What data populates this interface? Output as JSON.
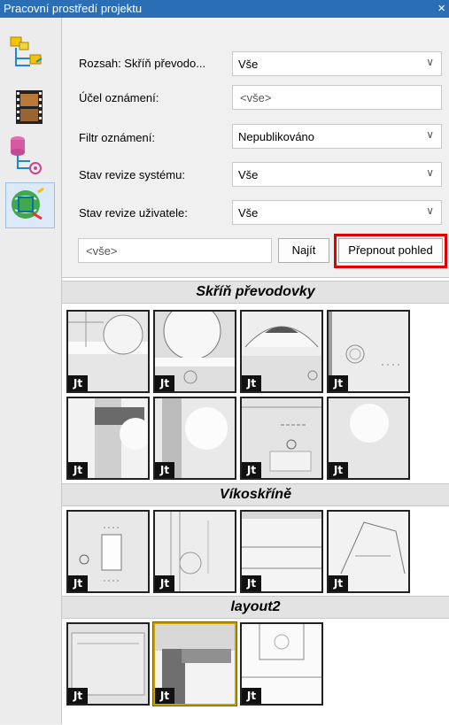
{
  "window": {
    "title": "Pracovní prostředí projektu",
    "close_glyph": "×"
  },
  "sidebar": {
    "icons": [
      "structure-tree-icon",
      "film-icon",
      "database-tree-icon",
      "globe-cube-icon"
    ],
    "active_index": 3
  },
  "form": {
    "scope_label": "Rozsah: Skříň převodo...",
    "scope_value": "Vše",
    "purpose_label": "Účel oznámení:",
    "purpose_value": "<vše>",
    "filter_label": "Filtr oznámení:",
    "filter_value": "Nepublikováno",
    "system_rev_label": "Stav revize systému:",
    "system_rev_value": "Vše",
    "user_rev_label": "Stav revize uživatele:",
    "user_rev_value": "Vše",
    "search_value": "<vše>",
    "find_button": "Najít",
    "switch_view_button": "Přepnout pohled"
  },
  "gallery": {
    "groups": [
      {
        "title": "Skříň převodovky",
        "thumbnail_count": 8
      },
      {
        "title": "Víkoskříně",
        "thumbnail_count": 4
      },
      {
        "title": "layout2",
        "thumbnail_count": 3,
        "selected_index": 1
      }
    ],
    "badge_text": "Jt"
  },
  "colors": {
    "titlebar": "#2a6fb6",
    "highlight": "#e00000",
    "selected_border": "#c8a000"
  }
}
